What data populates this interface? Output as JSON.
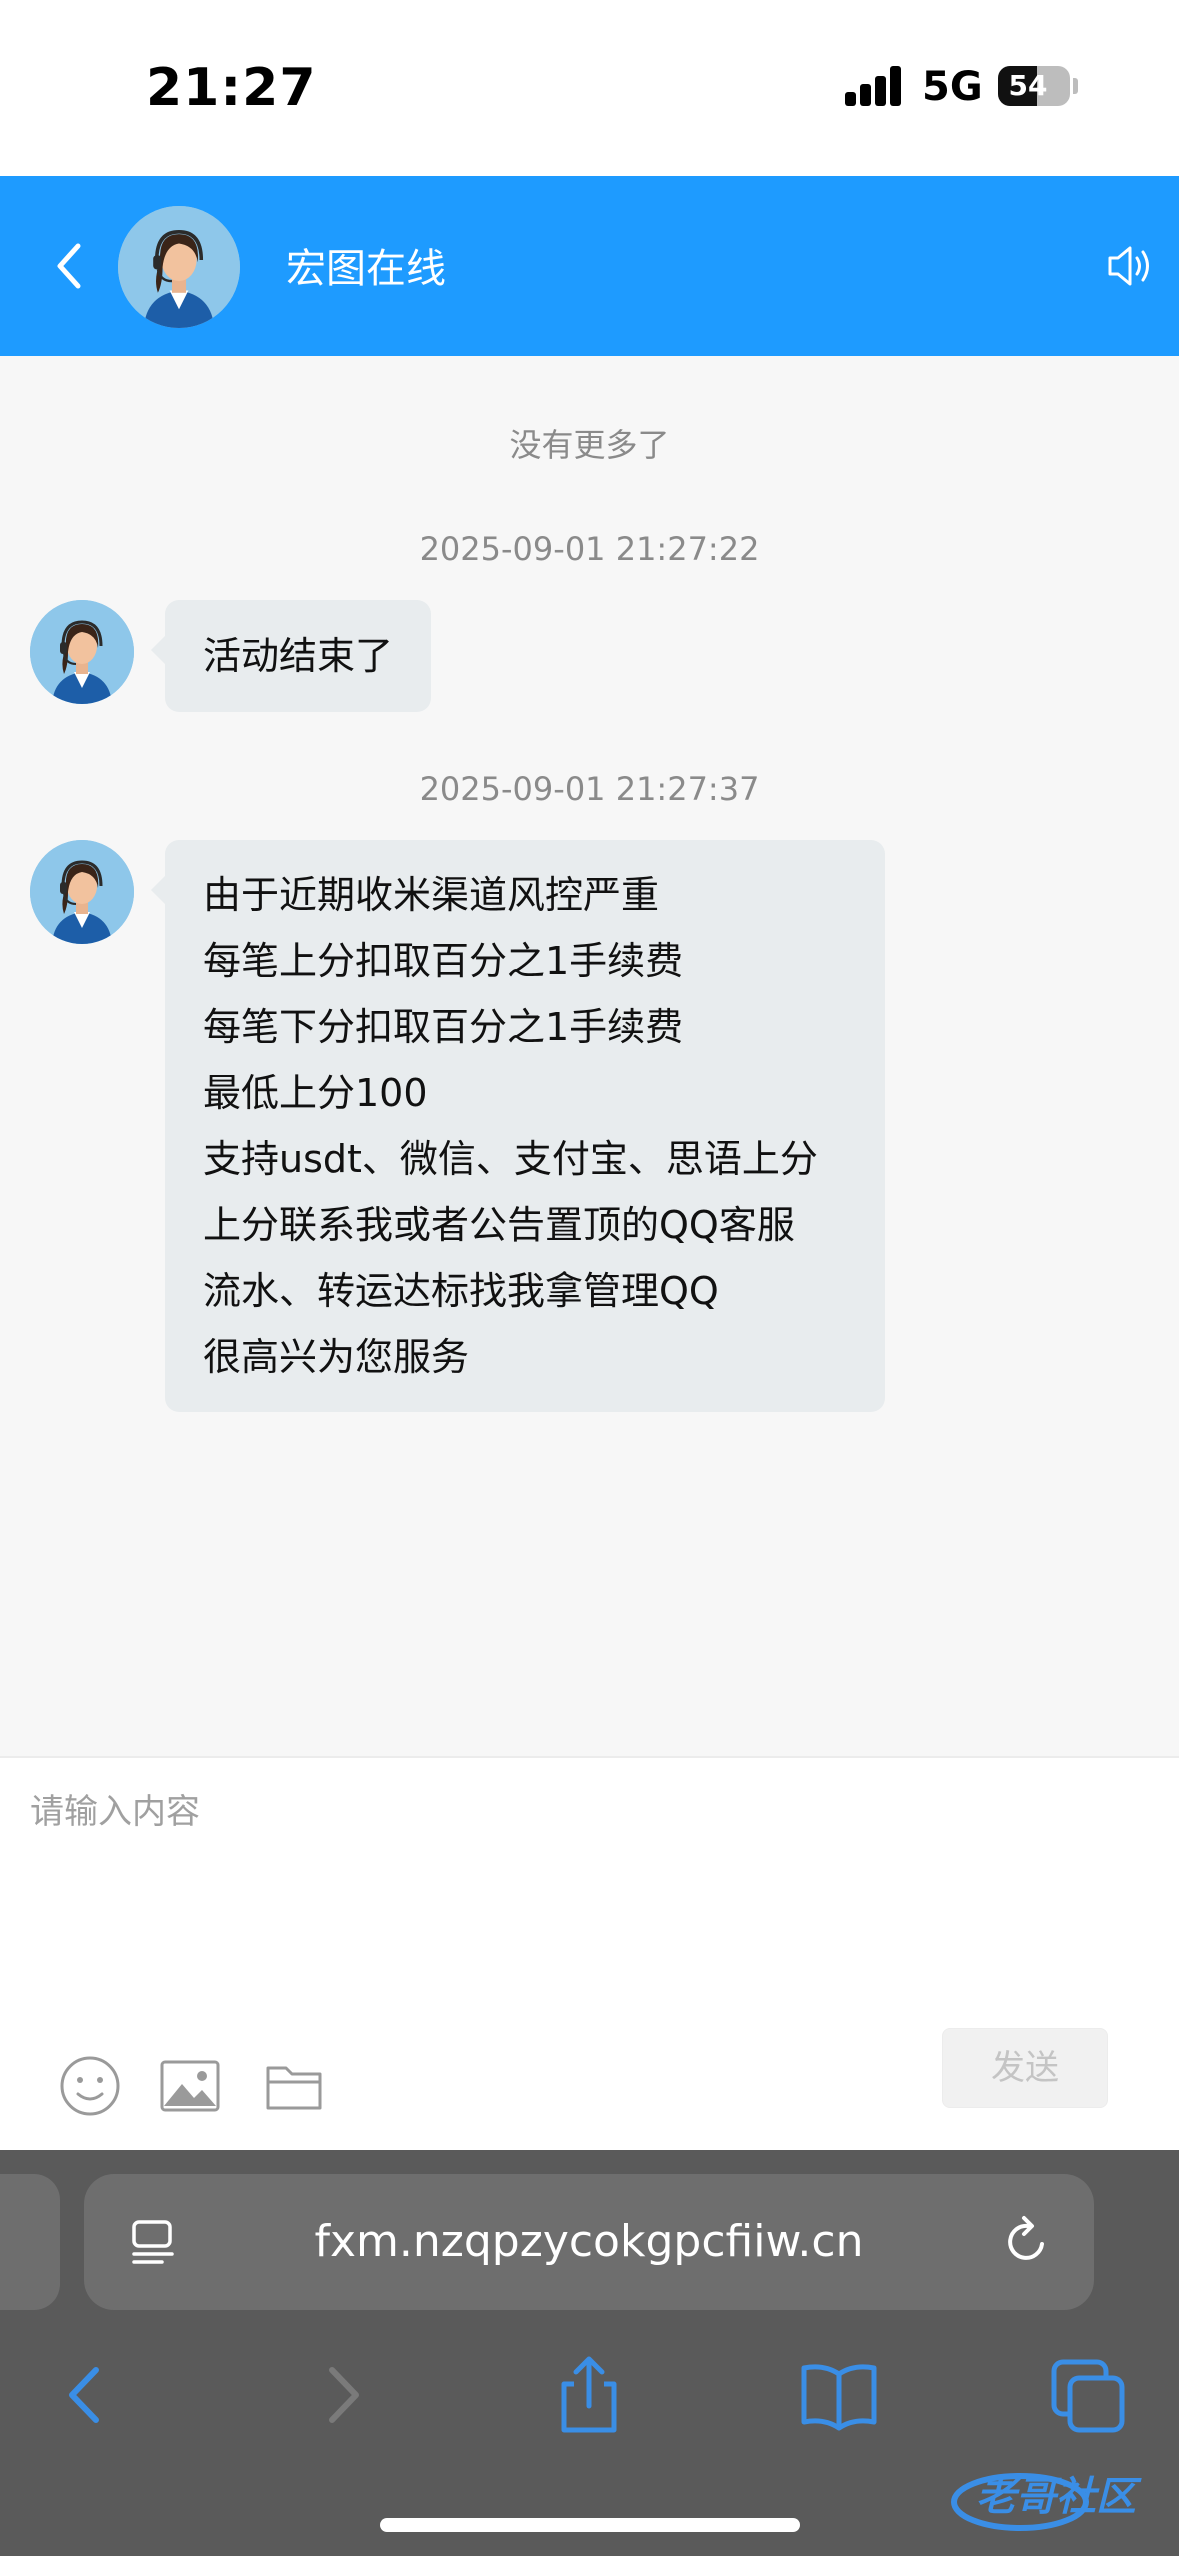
{
  "status_bar": {
    "time": "21:27",
    "network": "5G",
    "battery": "54",
    "battery_level": 0.54
  },
  "header": {
    "title": "宏图在线",
    "avatar_icon": "agent-avatar-icon",
    "back_icon": "chevron-left-icon",
    "sound_icon": "speaker-icon"
  },
  "messages": {
    "no_more": "没有更多了",
    "items": [
      {
        "timestamp": "2025-09-01 21:27:22",
        "lines": [
          "活动结束了"
        ]
      },
      {
        "timestamp": "2025-09-01 21:27:37",
        "lines": [
          "由于近期收米渠道风控严重",
          "每笔上分扣取百分之1手续费",
          "每笔下分扣取百分之1手续费",
          "最低上分100",
          "支持usdt、微信、支付宝、思语上分",
          "上分联系我或者公告置顶的QQ客服",
          "流水、转运达标找我拿管理QQ",
          "很高兴为您服务"
        ]
      }
    ]
  },
  "input": {
    "placeholder": "请输入内容",
    "value": "",
    "send_label": "发送"
  },
  "browser": {
    "url": "fxm.nzqpzycokgpcfiiw.cn"
  },
  "watermark": {
    "text": "老哥社区"
  },
  "colors": {
    "header": "#1e9bff",
    "bubble": "#e8ecee",
    "browser": "#5a5a5a",
    "nav_active": "#3a8ee6"
  }
}
